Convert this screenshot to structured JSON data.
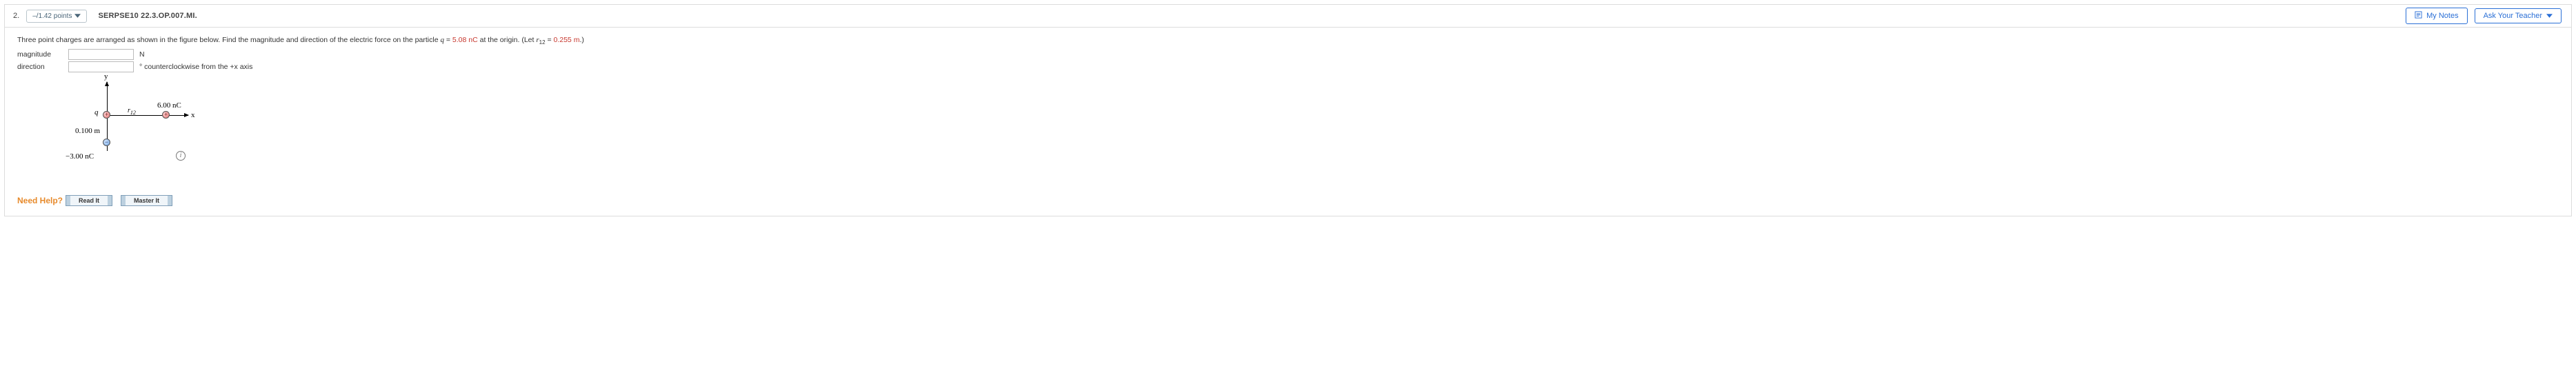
{
  "question": {
    "number": "2.",
    "points": "–/1.42 points",
    "code": "SERPSE10 22.3.OP.007.MI.",
    "my_notes": "My Notes",
    "ask_teacher": "Ask Your Teacher"
  },
  "prompt": {
    "text_a": "Three point charges are arranged as shown in the figure below. Find the magnitude and direction of the electric force on the particle ",
    "q_sym": "q",
    "eq1": " = ",
    "q_val": "5.08 nC",
    "text_b": " at the origin. (Let ",
    "r_sym": "r",
    "r_sub": "12",
    "eq2": " = ",
    "r_val": "0.255 m",
    "text_c": ".)"
  },
  "fields": {
    "mag_label": "magnitude",
    "mag_unit": "N",
    "dir_label": "direction",
    "dir_unit": "° counterclockwise from the +x axis"
  },
  "figure": {
    "y": "y",
    "x": "x",
    "q": "q",
    "r12_r": "r",
    "r12_sub": "12",
    "c_top": "6.00 nC",
    "d_left": "0.100 m",
    "c_bot": "−3.00 nC",
    "plus": "+",
    "minus": "−",
    "info": "i"
  },
  "help": {
    "label": "Need Help?",
    "read": "Read It",
    "master": "Master It"
  }
}
